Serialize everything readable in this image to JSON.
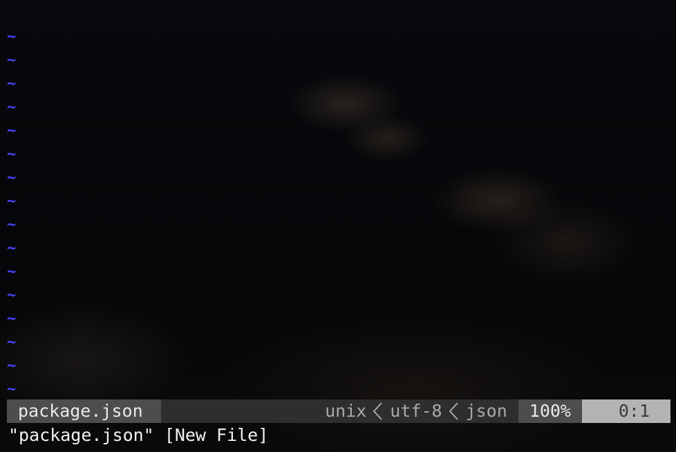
{
  "buffer": {
    "filler_char": "~",
    "empty_line_count": 16
  },
  "statusline": {
    "filename": "package.json",
    "fileformat": "unix",
    "encoding": "utf-8",
    "filetype": "json",
    "percent": "100%",
    "position": "0:1",
    "separator_icon": "chevron-left-icon"
  },
  "cmdline": {
    "message": "\"package.json\" [New File]"
  },
  "colors": {
    "tilde": "#4a44ff",
    "status_file_bg": "#4d4d4d",
    "status_mid_bg": "#2e2e2e",
    "status_pos_bg": "#b3b3b3",
    "background": "#050608"
  }
}
